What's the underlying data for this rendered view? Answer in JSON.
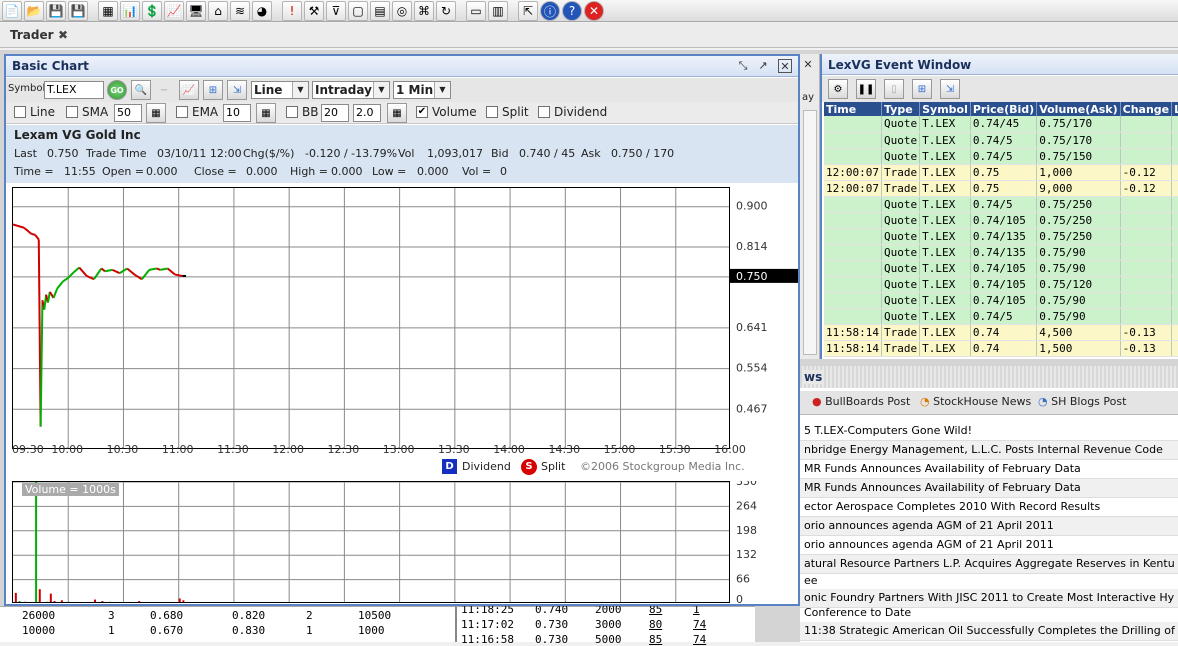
{
  "tab": {
    "label": "Trader",
    "close": "✖"
  },
  "toolbar": {
    "icons": [
      "new-icon",
      "open-icon",
      "save-icon",
      "save-as-icon",
      "table-icon",
      "chart-icon",
      "money-icon",
      "line-chart-icon",
      "monitor-icon",
      "home-icon",
      "rss-icon",
      "pie-icon",
      "alert-icon",
      "tools-icon",
      "filter-icon",
      "document-icon",
      "clipboard-icon",
      "globe-icon",
      "network-icon",
      "refresh-icon",
      "layout-icon",
      "layout2-icon",
      "export-icon",
      "info-icon",
      "help-icon",
      "close-icon"
    ]
  },
  "chart_window": {
    "title": "Basic Chart",
    "symbol_label": "Symbol",
    "symbol_value": "T.LEX",
    "go_label": "GO",
    "chart_type": "Line",
    "range": "Intraday",
    "interval": "1 Min",
    "indicators": {
      "line": {
        "label": "Line",
        "checked": false
      },
      "sma": {
        "label": "SMA",
        "value": "50",
        "checked": false
      },
      "ema": {
        "label": "EMA",
        "value": "10",
        "checked": false
      },
      "bb": {
        "label": "BB",
        "value": "20",
        "dev": "2.0",
        "checked": false
      },
      "volume": {
        "label": "Volume",
        "checked": true
      },
      "split": {
        "label": "Split",
        "checked": false
      },
      "dividend": {
        "label": "Dividend",
        "checked": false
      }
    },
    "company": "Lexam VG Gold Inc",
    "quote": {
      "last_label": "Last",
      "last": "0.750",
      "trade_time_label": "Trade Time",
      "trade_time": "03/10/11 12:00",
      "chg_label": "Chg($/%)",
      "chg": "-0.120 / -13.79%",
      "vol_label": "Vol",
      "vol": "1,093,017",
      "bid_label": "Bid",
      "bid": "0.740 / 45",
      "ask_label": "Ask",
      "ask": "0.750 / 170"
    },
    "bar_info": {
      "time_label": "Time =",
      "time": "11:55",
      "open_label": "Open =",
      "open": "0.000",
      "close_label": "Close =",
      "close": "0.000",
      "high_label": "High =",
      "high": "0.000",
      "low_label": "Low =",
      "low": "0.000",
      "vol_label": "Vol =",
      "vol": "0"
    },
    "legend": {
      "dividend_mark": "D",
      "dividend": "Dividend",
      "split_mark": "S",
      "split": "Split",
      "copyright": "©2006 Stockgroup Media Inc."
    },
    "volume_label": "Volume = 1000s"
  },
  "chart_data": [
    {
      "type": "line",
      "name": "price",
      "x_ticks": [
        "09:30",
        "10:00",
        "10:30",
        "11:00",
        "11:30",
        "12:00",
        "12:30",
        "13:00",
        "13:30",
        "14:00",
        "14:30",
        "15:00",
        "15:30",
        "16:00"
      ],
      "y_ticks": [
        "0.900",
        "0.814",
        "0.750",
        "0.641",
        "0.554",
        "0.467"
      ],
      "current_label": "0.750",
      "x_minutes": [
        0,
        6,
        10,
        12,
        14,
        15,
        16,
        17,
        18,
        19,
        20,
        22,
        24,
        27,
        30,
        33,
        36,
        40,
        44,
        48,
        50,
        54,
        58,
        62,
        66,
        70,
        74,
        78,
        80,
        84,
        88,
        92,
        94
      ],
      "values": [
        0.862,
        0.855,
        0.842,
        0.84,
        0.83,
        0.43,
        0.7,
        0.68,
        0.712,
        0.695,
        0.718,
        0.705,
        0.725,
        0.74,
        0.748,
        0.76,
        0.77,
        0.752,
        0.745,
        0.768,
        0.762,
        0.765,
        0.758,
        0.768,
        0.755,
        0.745,
        0.765,
        0.768,
        0.765,
        0.768,
        0.755,
        0.752,
        0.752
      ],
      "xlim": [
        0,
        390
      ],
      "ylim": [
        0.38,
        0.94
      ],
      "colors": {
        "up": "#00b000",
        "down": "#d00000",
        "flat": "#000000"
      }
    },
    {
      "type": "bar",
      "name": "volume",
      "y_ticks": [
        "330",
        "264",
        "198",
        "132",
        "66",
        "0"
      ],
      "ylim": [
        0,
        330
      ],
      "x_minutes": [
        1,
        3,
        6,
        9,
        12,
        14,
        16,
        18,
        20,
        22,
        24,
        26,
        28,
        30,
        33,
        36,
        40,
        44,
        48,
        52,
        56,
        60,
        64,
        68,
        72,
        76,
        80,
        84,
        88,
        90,
        92
      ],
      "values": [
        30,
        8,
        6,
        4,
        330,
        40,
        4,
        6,
        28,
        8,
        4,
        10,
        3,
        6,
        5,
        4,
        4,
        12,
        8,
        6,
        4,
        3,
        5,
        8,
        5,
        3,
        4,
        3,
        2,
        15,
        10
      ],
      "colors": {
        "up": "#00b000",
        "down": "#d00000"
      }
    }
  ],
  "event_window": {
    "title": "LexVG Event Window",
    "columns": [
      "Time",
      "Type",
      "Symbol",
      "Price(Bid)",
      "Volume(Ask)",
      "Change",
      "L"
    ],
    "rows": [
      [
        "",
        "Quote",
        "T.LEX",
        "0.74/45",
        "0.75/170",
        ""
      ],
      [
        "",
        "Quote",
        "T.LEX",
        "0.74/5",
        "0.75/170",
        ""
      ],
      [
        "",
        "Quote",
        "T.LEX",
        "0.74/5",
        "0.75/150",
        ""
      ],
      [
        "12:00:07",
        "Trade",
        "T.LEX",
        "0.75",
        "1,000",
        "-0.12"
      ],
      [
        "12:00:07",
        "Trade",
        "T.LEX",
        "0.75",
        "9,000",
        "-0.12"
      ],
      [
        "",
        "Quote",
        "T.LEX",
        "0.74/5",
        "0.75/250",
        ""
      ],
      [
        "",
        "Quote",
        "T.LEX",
        "0.74/105",
        "0.75/250",
        ""
      ],
      [
        "",
        "Quote",
        "T.LEX",
        "0.74/135",
        "0.75/250",
        ""
      ],
      [
        "",
        "Quote",
        "T.LEX",
        "0.74/135",
        "0.75/90",
        ""
      ],
      [
        "",
        "Quote",
        "T.LEX",
        "0.74/105",
        "0.75/90",
        ""
      ],
      [
        "",
        "Quote",
        "T.LEX",
        "0.74/105",
        "0.75/120",
        ""
      ],
      [
        "",
        "Quote",
        "T.LEX",
        "0.74/105",
        "0.75/90",
        ""
      ],
      [
        "",
        "Quote",
        "T.LEX",
        "0.74/5",
        "0.75/90",
        ""
      ],
      [
        "11:58:14",
        "Trade",
        "T.LEX",
        "0.74",
        "4,500",
        "-0.13"
      ],
      [
        "11:58:14",
        "Trade",
        "T.LEX",
        "0.74",
        "1,500",
        "-0.13"
      ]
    ]
  },
  "news": {
    "title_partial": "ws",
    "tabs": [
      "BullBoards Post",
      "StockHouse News",
      "SH Blogs Post"
    ],
    "items": [
      "5 T.LEX-Computers Gone Wild!",
      "nbridge Energy Management, L.L.C. Posts Internal Revenue Code",
      "MR Funds Announces Availability of February Data",
      "MR Funds Announces Availability of February Data",
      "ector Aerospace Completes 2010 With Record Results",
      "orio announces agenda AGM of 21 April 2011",
      "orio announces agenda AGM of 21 April 2011",
      "atural Resource Partners L.P. Acquires Aggregate Reserves in Kentu",
      "ee",
      "onic Foundry Partners With JISC 2011 to Create Most Interactive Hy",
      "Conference to Date",
      "11:38 Strategic American Oil Successfully Completes the Drilling of Its Initia"
    ]
  },
  "side_label": "ay",
  "bottom_left_rows": [
    [
      "26000",
      "3",
      "0.680",
      "0.820",
      "2",
      "10500"
    ],
    [
      "10000",
      "1",
      "0.670",
      "0.830",
      "1",
      "1000"
    ]
  ],
  "bottom_mid_rows": [
    [
      "11:18:25",
      "0.740",
      "2000",
      "85",
      "1"
    ],
    [
      "11:17:02",
      "0.730",
      "3000",
      "80",
      "74"
    ],
    [
      "11:16:58",
      "0.730",
      "5000",
      "85",
      "74"
    ]
  ]
}
